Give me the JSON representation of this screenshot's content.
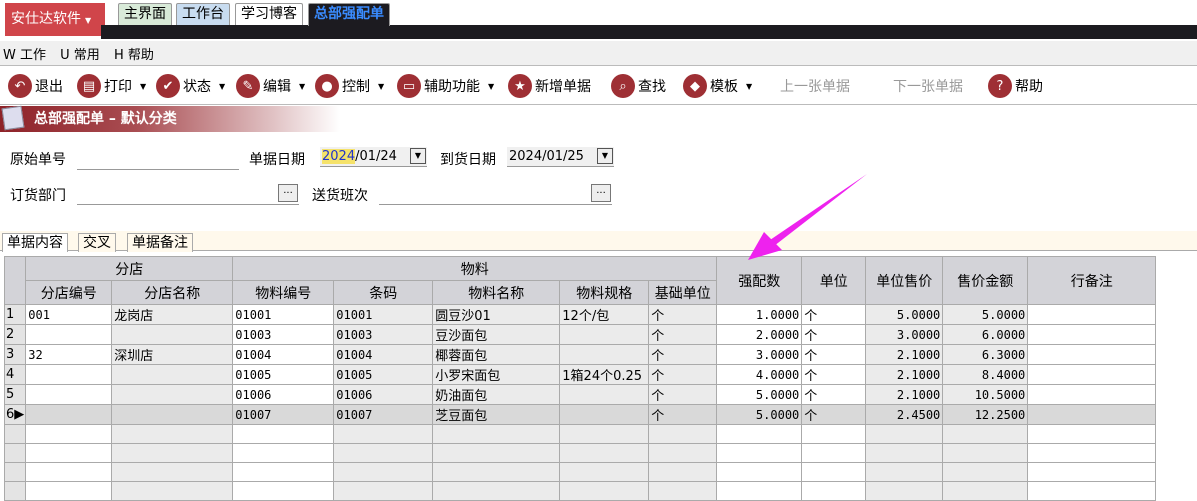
{
  "brand": {
    "label": "安仕达软件"
  },
  "top_tabs": [
    {
      "label": "主界面"
    },
    {
      "label": "工作台"
    },
    {
      "label": "学习博客"
    },
    {
      "label": "总部强配单"
    }
  ],
  "menu": [
    "W 工作",
    "U 常用",
    "H 帮助"
  ],
  "toolbar": {
    "exit": "退出",
    "print": "打印",
    "status": "状态",
    "edit": "编辑",
    "control": "控制",
    "aux": "辅助功能",
    "new": "新增单据",
    "find": "查找",
    "template": "模板",
    "prev": "上一张单据",
    "next": "下一张单据",
    "help": "帮助"
  },
  "title": "总部强配单 – 默认分类",
  "form": {
    "orig_no_label": "原始单号",
    "orig_no": "",
    "doc_date_label": "单据日期",
    "doc_date_year": "2024",
    "doc_date_rest": "/01/24",
    "arrive_date_label": "到货日期",
    "arrive_date": "2024/01/25",
    "dept_label": "订货部门",
    "dept": "",
    "shift_label": "送货班次",
    "shift": "",
    "ellipsis": "..."
  },
  "doc_tabs": [
    "单据内容",
    "交叉",
    "单据备注"
  ],
  "grid": {
    "groups": {
      "store": "分店",
      "material": "物料"
    },
    "columns": [
      "分店编号",
      "分店名称",
      "物料编号",
      "条码",
      "物料名称",
      "物料规格",
      "基础单位",
      "强配数",
      "单位",
      "单位售价",
      "售价金额",
      "行备注"
    ],
    "rows": [
      {
        "n": "1",
        "store_no": "001",
        "store_name": "龙岗店",
        "mat_no": "01001",
        "barcode": "01001",
        "name": "圆豆沙01",
        "spec": "12个/包",
        "base_unit": "个",
        "qty": "1.0000",
        "unit": "个",
        "price": "5.0000",
        "amount": "5.0000",
        "remark": ""
      },
      {
        "n": "2",
        "store_no": "",
        "store_name": "",
        "mat_no": "01003",
        "barcode": "01003",
        "name": "豆沙面包",
        "spec": "",
        "base_unit": "个",
        "qty": "2.0000",
        "unit": "个",
        "price": "3.0000",
        "amount": "6.0000",
        "remark": ""
      },
      {
        "n": "3",
        "store_no": "32",
        "store_name": "深圳店",
        "mat_no": "01004",
        "barcode": "01004",
        "name": "椰蓉面包",
        "spec": "",
        "base_unit": "个",
        "qty": "3.0000",
        "unit": "个",
        "price": "2.1000",
        "amount": "6.3000",
        "remark": ""
      },
      {
        "n": "4",
        "store_no": "",
        "store_name": "",
        "mat_no": "01005",
        "barcode": "01005",
        "name": "小罗宋面包",
        "spec": "1箱24个0.25",
        "base_unit": "个",
        "qty": "4.0000",
        "unit": "个",
        "price": "2.1000",
        "amount": "8.4000",
        "remark": ""
      },
      {
        "n": "5",
        "store_no": "",
        "store_name": "",
        "mat_no": "01006",
        "barcode": "01006",
        "name": "奶油面包",
        "spec": "",
        "base_unit": "个",
        "qty": "5.0000",
        "unit": "个",
        "price": "2.1000",
        "amount": "10.5000",
        "remark": ""
      },
      {
        "n": "6",
        "store_no": "",
        "store_name": "",
        "mat_no": "01007",
        "barcode": "01007",
        "name": "芝豆面包",
        "spec": "",
        "base_unit": "个",
        "qty": "5.0000",
        "unit": "个",
        "price": "2.4500",
        "amount": "12.2500",
        "remark": ""
      }
    ]
  },
  "colors": {
    "brand": "#d0454a",
    "icon": "#9e2f34",
    "arrow": "#ee22ee"
  }
}
